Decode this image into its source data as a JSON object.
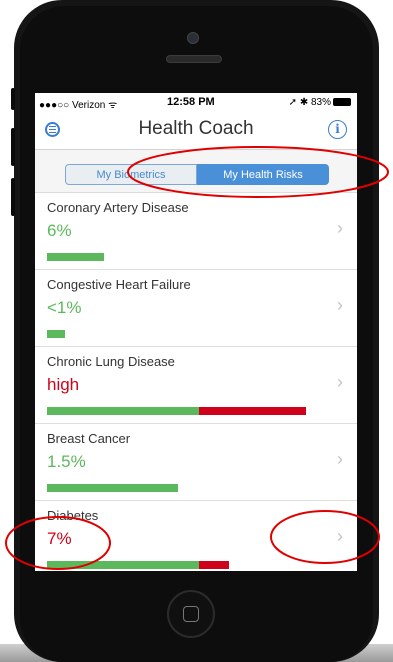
{
  "status_bar": {
    "carrier": "●●●○○ Verizon ᯤ",
    "time": "12:58 PM",
    "right": "➚ ✱ 83%"
  },
  "navbar": {
    "title": "Health Coach",
    "menu_icon": "menu-icon",
    "info_icon": "info-icon",
    "info_glyph": "i"
  },
  "segmented": {
    "left_label": "My Biometrics",
    "right_label": "My Health Risks",
    "selected": "My Health Risks"
  },
  "risks": [
    {
      "name": "Coronary Artery Disease",
      "value": "6%",
      "color": "#5cb85c",
      "green_fraction": 0.19,
      "red_fraction": 0
    },
    {
      "name": "Congestive Heart Failure",
      "value": "<1%",
      "color": "#5cb85c",
      "green_fraction": 0.06,
      "red_fraction": 0
    },
    {
      "name": "Chronic Lung Disease",
      "value": "high",
      "color": "#d0021b",
      "green_fraction": 0.51,
      "red_fraction": 0.36
    },
    {
      "name": "Breast Cancer",
      "value": "1.5%",
      "color": "#5cb85c",
      "green_fraction": 0.44,
      "red_fraction": 0
    },
    {
      "name": "Diabetes",
      "value": "7%",
      "color": "#d0021b",
      "green_fraction": 0.51,
      "red_fraction": 0.1
    }
  ],
  "colors": {
    "accent": "#4a90d9",
    "green": "#5cb85c",
    "red": "#d0021b",
    "annotation": "#e00000"
  }
}
